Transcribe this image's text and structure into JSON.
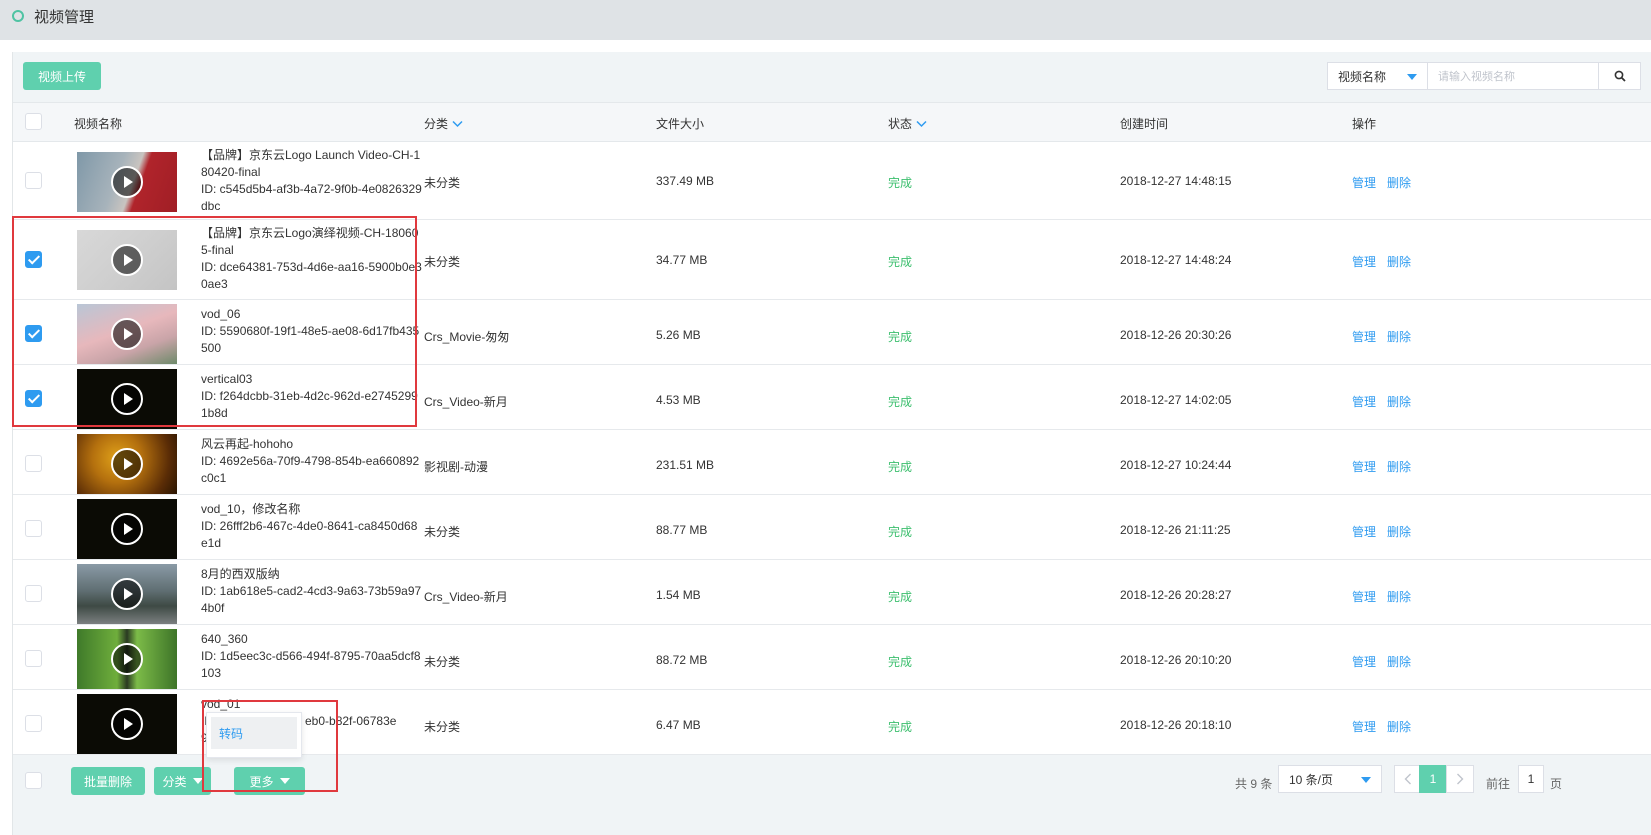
{
  "page": {
    "title": "视频管理"
  },
  "toolbar": {
    "upload_label": "视频上传",
    "search_field": "视频名称",
    "search_placeholder": "请输入视频名称"
  },
  "table": {
    "columns": {
      "name": "视频名称",
      "category": "分类",
      "size": "文件大小",
      "status": "状态",
      "created": "创建时间",
      "action": "操作"
    },
    "actions": {
      "manage": "管理",
      "delete": "删除"
    },
    "rows": [
      {
        "name": "【品牌】京东云Logo Launch Video-CH-180420-final",
        "id": "ID: c545d5b4-af3b-4a72-9f0b-4e0826329dbc",
        "category": "未分类",
        "size": "337.49 MB",
        "status": "完成",
        "created": "2018-12-27 14:48:15",
        "checked": false,
        "thumb": "jd"
      },
      {
        "name": "【品牌】京东云Logo演绎视频-CH-180605-final",
        "id": "ID: dce64381-753d-4d6e-aa16-5900b0e30ae3",
        "category": "未分类",
        "size": "34.77 MB",
        "status": "完成",
        "created": "2018-12-27 14:48:24",
        "checked": true,
        "thumb": "gray"
      },
      {
        "name": "vod_06",
        "id": "ID: 5590680f-19f1-48e5-ae08-6d17fb435500",
        "category": "Crs_Movie-匆匆",
        "size": "5.26 MB",
        "status": "完成",
        "created": "2018-12-26 20:30:26",
        "checked": true,
        "thumb": "sky"
      },
      {
        "name": "vertical03",
        "id": "ID: f264dcbb-31eb-4d2c-962d-e27452991b8d",
        "category": "Crs_Video-新月",
        "size": "4.53 MB",
        "status": "完成",
        "created": "2018-12-27 14:02:05",
        "checked": true,
        "thumb": "black"
      },
      {
        "name": "风云再起-hohoho",
        "id": "ID: 4692e56a-70f9-4798-854b-ea660892c0c1",
        "category": "影视剧-动漫",
        "size": "231.51 MB",
        "status": "完成",
        "created": "2018-12-27 10:24:44",
        "checked": false,
        "thumb": "gold"
      },
      {
        "name": "vod_10，修改名称",
        "id": "ID: 26fff2b6-467c-4de0-8641-ca8450d68e1d",
        "category": "未分类",
        "size": "88.77 MB",
        "status": "完成",
        "created": "2018-12-26 21:11:25",
        "checked": false,
        "thumb": "black"
      },
      {
        "name": "8月的西双版纳",
        "id": "ID: 1ab618e5-cad2-4cd3-9a63-73b59a974b0f",
        "category": "Crs_Video-新月",
        "size": "1.54 MB",
        "status": "完成",
        "created": "2018-12-26 20:28:27",
        "checked": false,
        "thumb": "street"
      },
      {
        "name": "640_360",
        "id": "ID: 1d5eec3c-d566-494f-8795-70aa5dcf8103",
        "category": "未分类",
        "size": "88.72 MB",
        "status": "完成",
        "created": "2018-12-26 20:10:20",
        "checked": false,
        "thumb": "green"
      },
      {
        "name": "vod_01",
        "id": "ID",
        "id_tail": "eb0-b82f-06783e",
        "id_line2": "9e7",
        "category": "未分类",
        "size": "6.47 MB",
        "status": "完成",
        "created": "2018-12-26 20:18:10",
        "checked": false,
        "thumb": "black"
      }
    ]
  },
  "footer": {
    "batch_delete": "批量删除",
    "category": "分类",
    "more": "更多",
    "total": "共 9 条",
    "page_size": "10 条/页",
    "current_page": "1",
    "goto_label": "前往",
    "goto_value": "1",
    "goto_unit": "页"
  },
  "more_menu": {
    "transcode": "转码"
  },
  "colors": {
    "accent": "#5fd0ae",
    "link": "#2e9bf0",
    "status_done": "#3cbf6e",
    "highlight": "#e0393e"
  }
}
